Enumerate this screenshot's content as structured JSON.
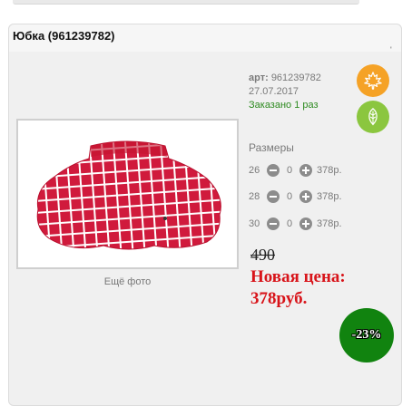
{
  "product": {
    "title": "Юбка (961239782)",
    "tick": "'",
    "article_label": "арт:",
    "article_value": "961239782",
    "date": "27.07.2017",
    "ordered": "Заказано 1 раз",
    "more_photos": "Ещё фото",
    "image_icon": "skirt-photo"
  },
  "badges": [
    {
      "icon": "maple-leaf-icon",
      "color": "#f5a226"
    },
    {
      "icon": "leaf-icon",
      "color": "#8bc63f"
    }
  ],
  "sizes": {
    "title": "Размеры",
    "rows": [
      {
        "size": "26",
        "qty": "0",
        "price": "378р."
      },
      {
        "size": "28",
        "qty": "0",
        "price": "378р."
      },
      {
        "size": "30",
        "qty": "0",
        "price": "378р."
      }
    ]
  },
  "price": {
    "old": "490",
    "new_line1": "Новая цена:",
    "new_line2": "378руб.",
    "discount": "-23%"
  },
  "colors": {
    "new_price": "#d8141a",
    "discount_bg": "#11830f",
    "skirt": "#d01a3c"
  }
}
